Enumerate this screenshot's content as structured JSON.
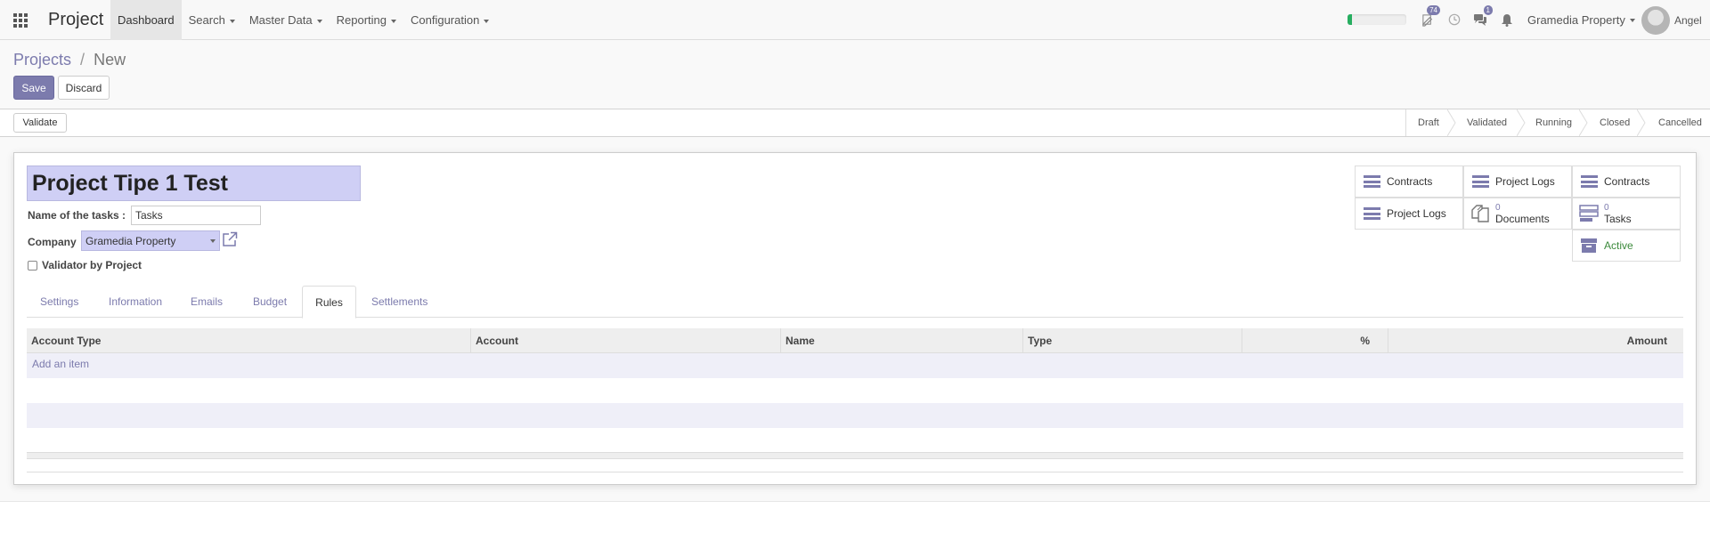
{
  "navbar": {
    "brand": "Project",
    "menu": [
      {
        "label": "Dashboard",
        "dropdown": false
      },
      {
        "label": "Search",
        "dropdown": true
      },
      {
        "label": "Master Data",
        "dropdown": true
      },
      {
        "label": "Reporting",
        "dropdown": true
      },
      {
        "label": "Configuration",
        "dropdown": true
      }
    ],
    "progress": 0.08,
    "activity_badge": "74",
    "message_badge": "1",
    "company": "Gramedia Property",
    "user": "Angel"
  },
  "breadcrumb": {
    "parent": "Projects",
    "separator": "/",
    "current": "New"
  },
  "buttons": {
    "save": "Save",
    "discard": "Discard",
    "validate": "Validate"
  },
  "statusbar": {
    "stages": [
      "Draft",
      "Validated",
      "Running",
      "Closed",
      "Cancelled"
    ]
  },
  "form": {
    "name": "Project Tipe 1 Test",
    "tasks_label": "Name of the tasks :",
    "tasks_value": "Tasks",
    "company_label": "Company",
    "company_value": "Gramedia Property",
    "validator_label": "Validator by Project"
  },
  "smart_buttons": {
    "contracts_1": "Contracts",
    "project_logs_1": "Project Logs",
    "contracts_2": "Contracts",
    "project_logs_2": "Project Logs",
    "documents_count": "0",
    "documents_label": "Documents",
    "tasks_count": "0",
    "tasks_label": "Tasks",
    "active_label": "Active"
  },
  "tabs": [
    "Settings",
    "Information",
    "Emails",
    "Budget",
    "Rules",
    "Settlements"
  ],
  "active_tab": "Rules",
  "table": {
    "columns": [
      "Account Type",
      "Account",
      "Name",
      "Type",
      "%",
      "Amount"
    ],
    "add_item": "Add an item"
  },
  "colors": {
    "accent": "#7c7bad",
    "active_green": "#3c8a3c",
    "field_highlight": "#cfcff5"
  },
  "icons": [
    "apps-grid-icon",
    "edit-icon",
    "clock-icon",
    "comments-icon",
    "bell-icon",
    "external-link-icon",
    "list-icon",
    "documents-icon",
    "tasks-icon",
    "archive-icon"
  ]
}
